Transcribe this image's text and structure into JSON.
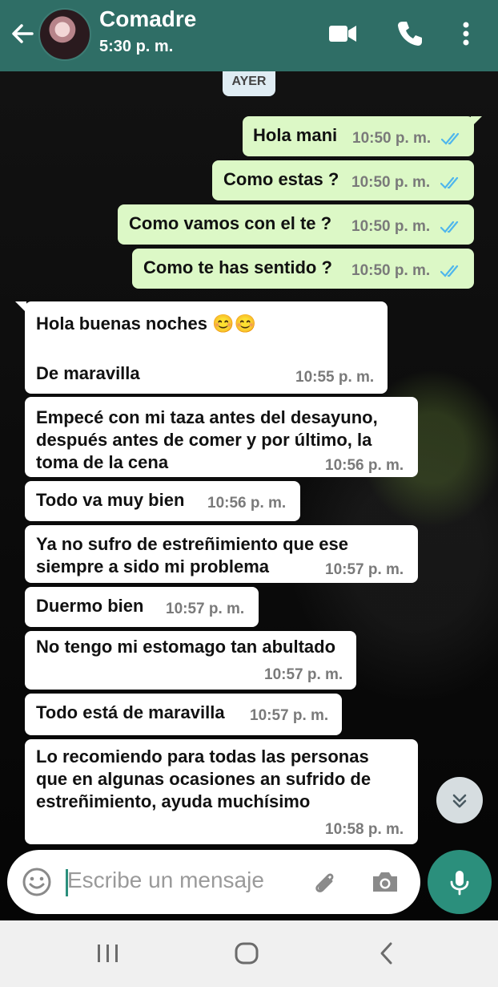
{
  "header": {
    "contact_name": "Comadre",
    "last_seen": "5:30 p. m."
  },
  "date_chip": "AYER",
  "messages": [
    {
      "text": "Hola mani",
      "time": "10:50 p. m."
    },
    {
      "text": "Como estas ?",
      "time": "10:50 p. m."
    },
    {
      "text": "Como vamos con el te  ?",
      "time": "10:50 p. m."
    },
    {
      "text": "Como te has sentido  ?",
      "time": "10:50 p. m."
    },
    {
      "line1": "Hola buenas noches 😊😊",
      "line2": "De maravilla",
      "time": "10:55 p. m."
    },
    {
      "line1": "Empecé con mi taza antes del desayuno,",
      "line2": "después antes de comer y por último, la",
      "line3": "toma de la cena",
      "time": "10:56 p. m."
    },
    {
      "text": "Todo va muy bien",
      "time": "10:56 p. m."
    },
    {
      "line1": "Ya no sufro de estreñimiento que ese",
      "line2": "siempre a sido mi problema",
      "time": "10:57 p. m."
    },
    {
      "text": "Duermo bien",
      "time": "10:57 p. m."
    },
    {
      "text": "No tengo mi estomago tan abultado",
      "time": "10:57 p. m."
    },
    {
      "text": "Todo está de maravilla",
      "time": "10:57 p. m."
    },
    {
      "line1": "Lo recomiendo para todas las personas",
      "line2": "que en algunas ocasiones an sufrido de",
      "line3": "estreñimiento, ayuda muchísimo",
      "time": "10:58 p. m."
    }
  ],
  "composer": {
    "placeholder": "Escribe un mensaje"
  },
  "colors": {
    "header": "#2f6e66",
    "outgoing": "#dcf8c6",
    "incoming": "#ffffff",
    "ticks": "#4fb6ec",
    "mic": "#2b8f7c"
  },
  "icons": [
    "back-arrow-icon",
    "video-call-icon",
    "phone-icon",
    "more-options-icon",
    "double-check-icon",
    "scroll-down-icon",
    "emoji-icon",
    "attach-icon",
    "camera-icon",
    "mic-icon",
    "recents-icon",
    "home-icon",
    "back-nav-icon"
  ]
}
